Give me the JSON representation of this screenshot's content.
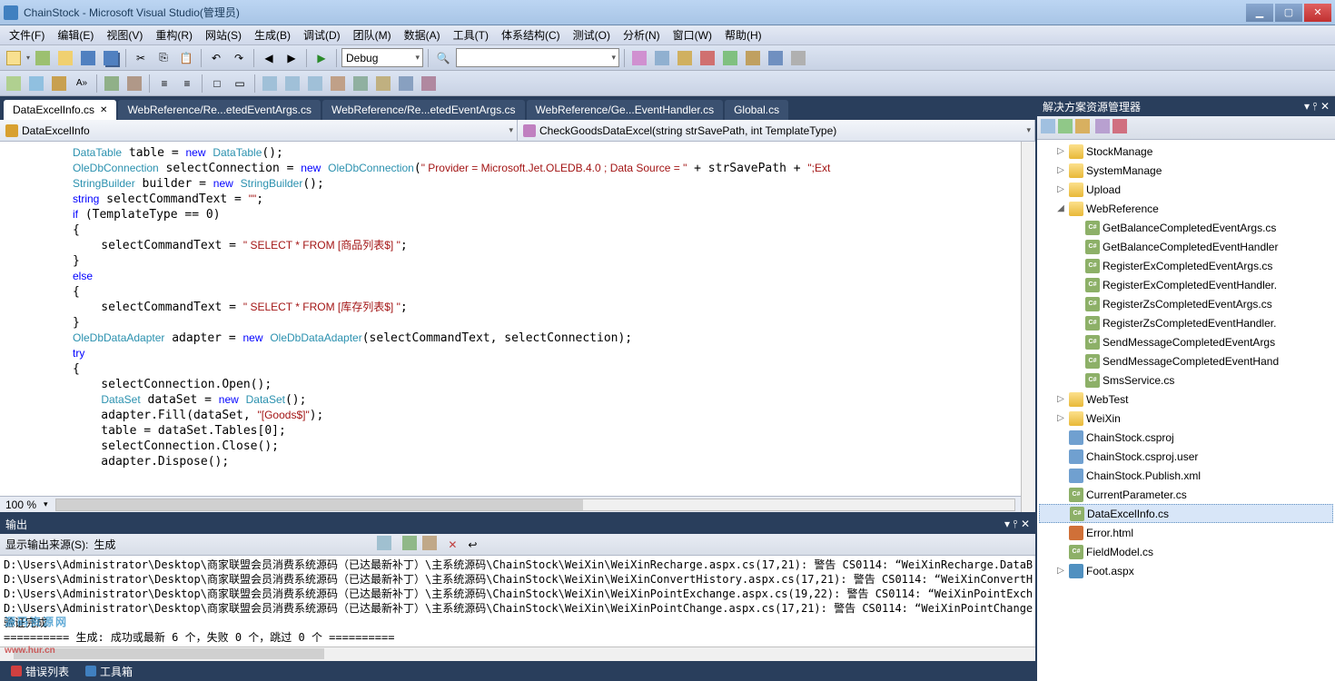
{
  "window": {
    "title": "ChainStock - Microsoft Visual Studio(管理员)"
  },
  "menu": [
    "文件(F)",
    "编辑(E)",
    "视图(V)",
    "重构(R)",
    "网站(S)",
    "生成(B)",
    "调试(D)",
    "团队(M)",
    "数据(A)",
    "工具(T)",
    "体系结构(C)",
    "测试(O)",
    "分析(N)",
    "窗口(W)",
    "帮助(H)"
  ],
  "config_combo": "Debug",
  "tabs": [
    {
      "label": "DataExcelInfo.cs",
      "active": true,
      "closable": true
    },
    {
      "label": "WebReference/Re...etedEventArgs.cs"
    },
    {
      "label": "WebReference/Re...etedEventArgs.cs"
    },
    {
      "label": "WebReference/Ge...EventHandler.cs"
    },
    {
      "label": "Global.cs"
    }
  ],
  "nav": {
    "class": "DataExcelInfo",
    "member": "CheckGoodsDataExcel(string strSavePath, int TemplateType)"
  },
  "zoom": "100 %",
  "output": {
    "title": "输出",
    "source_label": "显示输出来源(S):",
    "source": "生成",
    "lines": [
      "D:\\Users\\Administrator\\Desktop\\商家联盟会员消费系统源码（已达最新补丁）\\主系统源码\\ChainStock\\WeiXin\\WeiXinRecharge.aspx.cs(17,21): 警告 CS0114: “WeiXinRecharge.DataB",
      "D:\\Users\\Administrator\\Desktop\\商家联盟会员消费系统源码（已达最新补丁）\\主系统源码\\ChainStock\\WeiXin\\WeiXinConvertHistory.aspx.cs(17,21): 警告 CS0114: “WeiXinConvertH",
      "D:\\Users\\Administrator\\Desktop\\商家联盟会员消费系统源码（已达最新补丁）\\主系统源码\\ChainStock\\WeiXin\\WeiXinPointExchange.aspx.cs(19,22): 警告 CS0114: “WeiXinPointExch",
      "D:\\Users\\Administrator\\Desktop\\商家联盟会员消费系统源码（已达最新补丁）\\主系统源码\\ChainStock\\WeiXin\\WeiXinPointChange.aspx.cs(17,21): 警告 CS0114: “WeiXinPointChange",
      "验证完成",
      "========== 生成: 成功或最新 6 个，失败 0 个，跳过 0 个 =========="
    ]
  },
  "bottom_tabs": [
    {
      "label": "错误列表",
      "icon": "#d04040"
    },
    {
      "label": "工具箱",
      "icon": "#4080c0"
    }
  ],
  "solution": {
    "title": "解决方案资源管理器",
    "items": [
      {
        "d": 1,
        "exp": "▷",
        "ico": "folder",
        "label": "StockManage"
      },
      {
        "d": 1,
        "exp": "▷",
        "ico": "folder",
        "label": "SystemManage"
      },
      {
        "d": 1,
        "exp": "▷",
        "ico": "folder",
        "label": "Upload"
      },
      {
        "d": 1,
        "exp": "◢",
        "ico": "folder",
        "label": "WebReference"
      },
      {
        "d": 2,
        "exp": "",
        "ico": "cs",
        "label": "GetBalanceCompletedEventArgs.cs"
      },
      {
        "d": 2,
        "exp": "",
        "ico": "cs",
        "label": "GetBalanceCompletedEventHandler"
      },
      {
        "d": 2,
        "exp": "",
        "ico": "cs",
        "label": "RegisterExCompletedEventArgs.cs"
      },
      {
        "d": 2,
        "exp": "",
        "ico": "cs",
        "label": "RegisterExCompletedEventHandler."
      },
      {
        "d": 2,
        "exp": "",
        "ico": "cs",
        "label": "RegisterZsCompletedEventArgs.cs"
      },
      {
        "d": 2,
        "exp": "",
        "ico": "cs",
        "label": "RegisterZsCompletedEventHandler."
      },
      {
        "d": 2,
        "exp": "",
        "ico": "cs",
        "label": "SendMessageCompletedEventArgs"
      },
      {
        "d": 2,
        "exp": "",
        "ico": "cs",
        "label": "SendMessageCompletedEventHand"
      },
      {
        "d": 2,
        "exp": "",
        "ico": "cs",
        "label": "SmsService.cs"
      },
      {
        "d": 1,
        "exp": "▷",
        "ico": "folder",
        "label": "WebTest"
      },
      {
        "d": 1,
        "exp": "▷",
        "ico": "folder",
        "label": "WeiXin"
      },
      {
        "d": 1,
        "exp": "",
        "ico": "xml",
        "label": "ChainStock.csproj"
      },
      {
        "d": 1,
        "exp": "",
        "ico": "xml",
        "label": "ChainStock.csproj.user"
      },
      {
        "d": 1,
        "exp": "",
        "ico": "xml",
        "label": "ChainStock.Publish.xml"
      },
      {
        "d": 1,
        "exp": "",
        "ico": "cs",
        "label": "CurrentParameter.cs"
      },
      {
        "d": 1,
        "exp": "",
        "ico": "cs",
        "label": "DataExcelInfo.cs",
        "sel": true
      },
      {
        "d": 1,
        "exp": "",
        "ico": "html",
        "label": "Error.html"
      },
      {
        "d": 1,
        "exp": "",
        "ico": "cs",
        "label": "FieldModel.cs"
      },
      {
        "d": 1,
        "exp": "▷",
        "ico": "aspx",
        "label": "Foot.aspx"
      }
    ]
  },
  "watermark": {
    "main": "源码资源网",
    "sub": "www.hur.cn"
  }
}
